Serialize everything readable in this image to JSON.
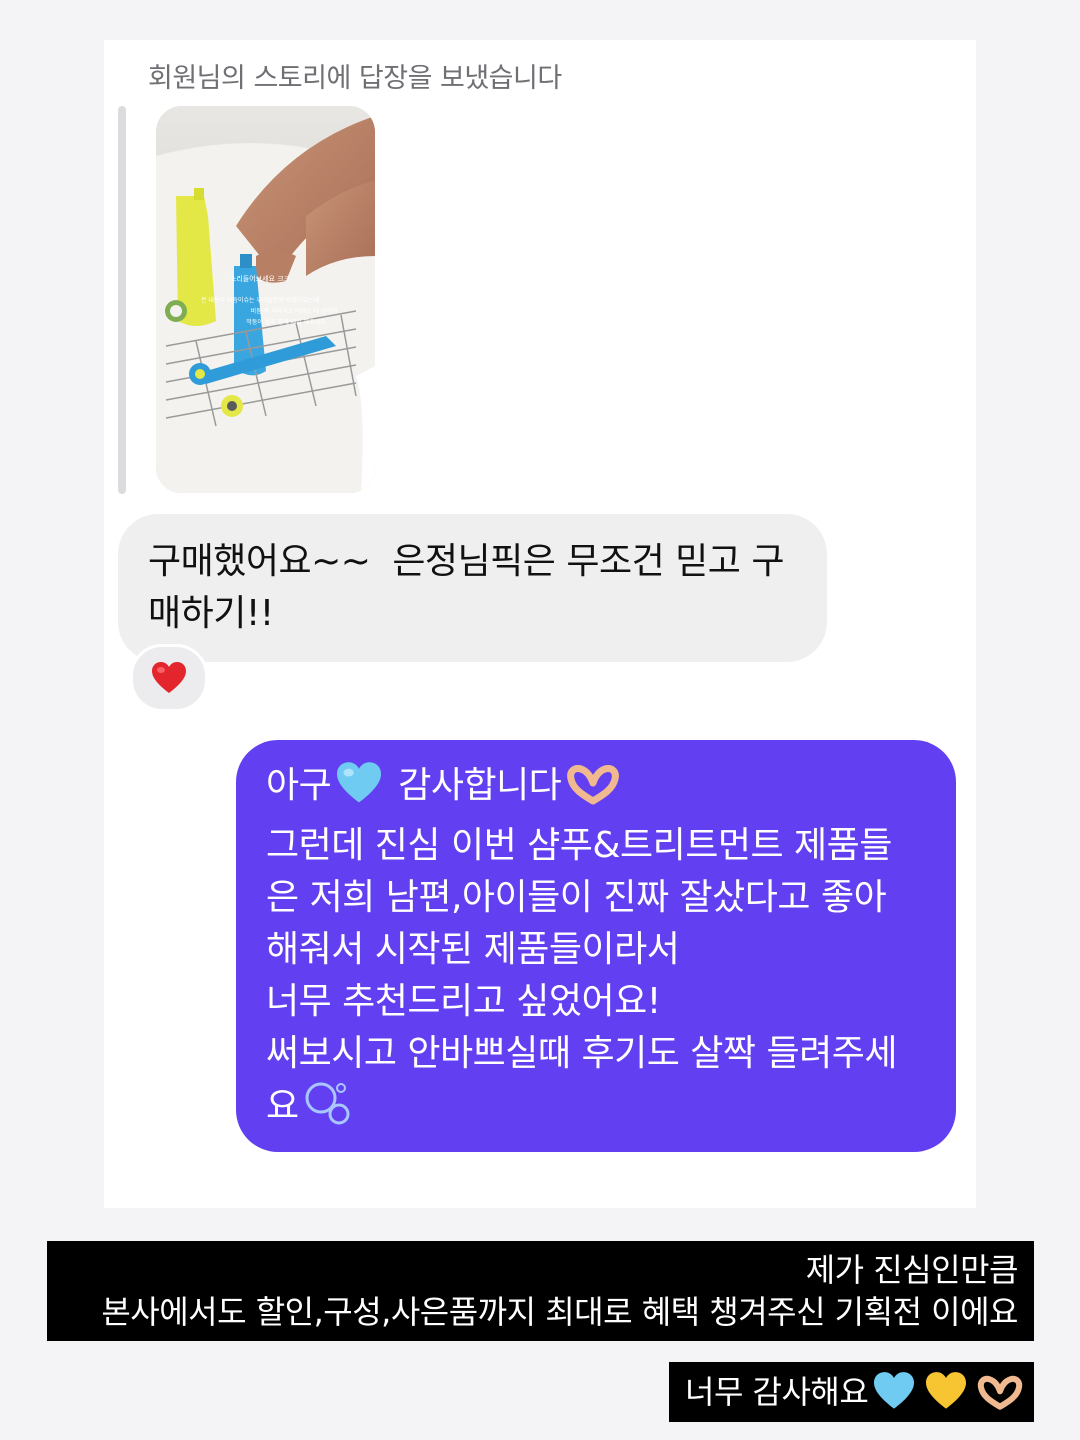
{
  "story_reply": {
    "caption": "회원님의 스토리에 답장을 보냈습니다",
    "thumbnail_overlay_text": [
      "소리들어보세요 크크",
      "은 내용주 비듬이슈는 우리들만의 비밀이었는데",
      "비듬 싹 사라지고 이정도 나 신기한",
      "막둥이 샴푸 함께 매일 해주네요"
    ]
  },
  "incoming_message": {
    "text": "구매했어요~~  은정님픽은 무조건 믿고 구매하기!!",
    "reaction": "heart-emoji"
  },
  "outgoing_message": {
    "lines": [
      "아구",
      "감사합니다",
      "그런데 진심 이번 샴푸&트리트먼트 제품들",
      "은 저희 남편,아이들이 진짜 잘샀다고 좋아",
      "해줘서 시작된 제품들이라서",
      "너무 추천드리고 싶었어요!",
      "써보시고 안바쁘실때 후기도 살짝 들려주세",
      "요"
    ],
    "bubble_color": "#6240f2"
  },
  "captions": {
    "line1": "제가 진심인만큼",
    "line2": "본사에서도 할인,구성,사은품까지 최대로 혜택 챙겨주신 기획전 이에요",
    "line3": "너무 감사해요"
  }
}
